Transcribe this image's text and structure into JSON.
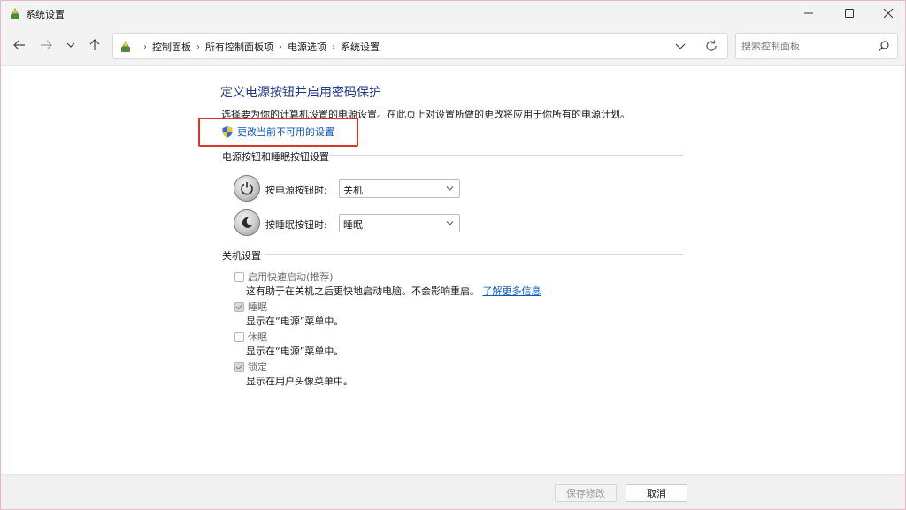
{
  "window": {
    "title": "系统设置",
    "minimize": "—",
    "maximize": "☐",
    "close": "✕"
  },
  "nav": {
    "breadcrumbs": [
      "控制面板",
      "所有控制面板项",
      "电源选项",
      "系统设置"
    ],
    "breadcrumb_separator": "›",
    "search_placeholder": "搜索控制面板"
  },
  "main": {
    "page_title": "定义电源按钮并启用密码保护",
    "description": "选择要为你的计算机设置的电源设置。在此页上对设置所做的更改将应用于你所有的电源计划。",
    "change_settings_link": "更改当前不可用的设置",
    "power_section": {
      "heading": "电源按钮和睡眠按钮设置",
      "power_button_label": "按电源按钮时:",
      "power_button_value": "关机",
      "sleep_button_label": "按睡眠按钮时:",
      "sleep_button_value": "睡眠"
    },
    "shutdown_section": {
      "heading": "关机设置",
      "options": [
        {
          "label": "启用快速启动(推荐)",
          "checked": false,
          "desc": "这有助于在关机之后更快地启动电脑。不会影响重启。",
          "link": "了解更多信息"
        },
        {
          "label": "睡眠",
          "checked": true,
          "desc": "显示在“电源”菜单中。"
        },
        {
          "label": "休眠",
          "checked": false,
          "desc": "显示在“电源”菜单中。"
        },
        {
          "label": "锁定",
          "checked": true,
          "desc": "显示在用户头像菜单中。"
        }
      ]
    }
  },
  "footer": {
    "save_label": "保存修改",
    "cancel_label": "取消"
  },
  "colors": {
    "title_blue": "#1e3a8a",
    "link_blue": "#0a58c2",
    "highlight_red": "#e0342a"
  }
}
